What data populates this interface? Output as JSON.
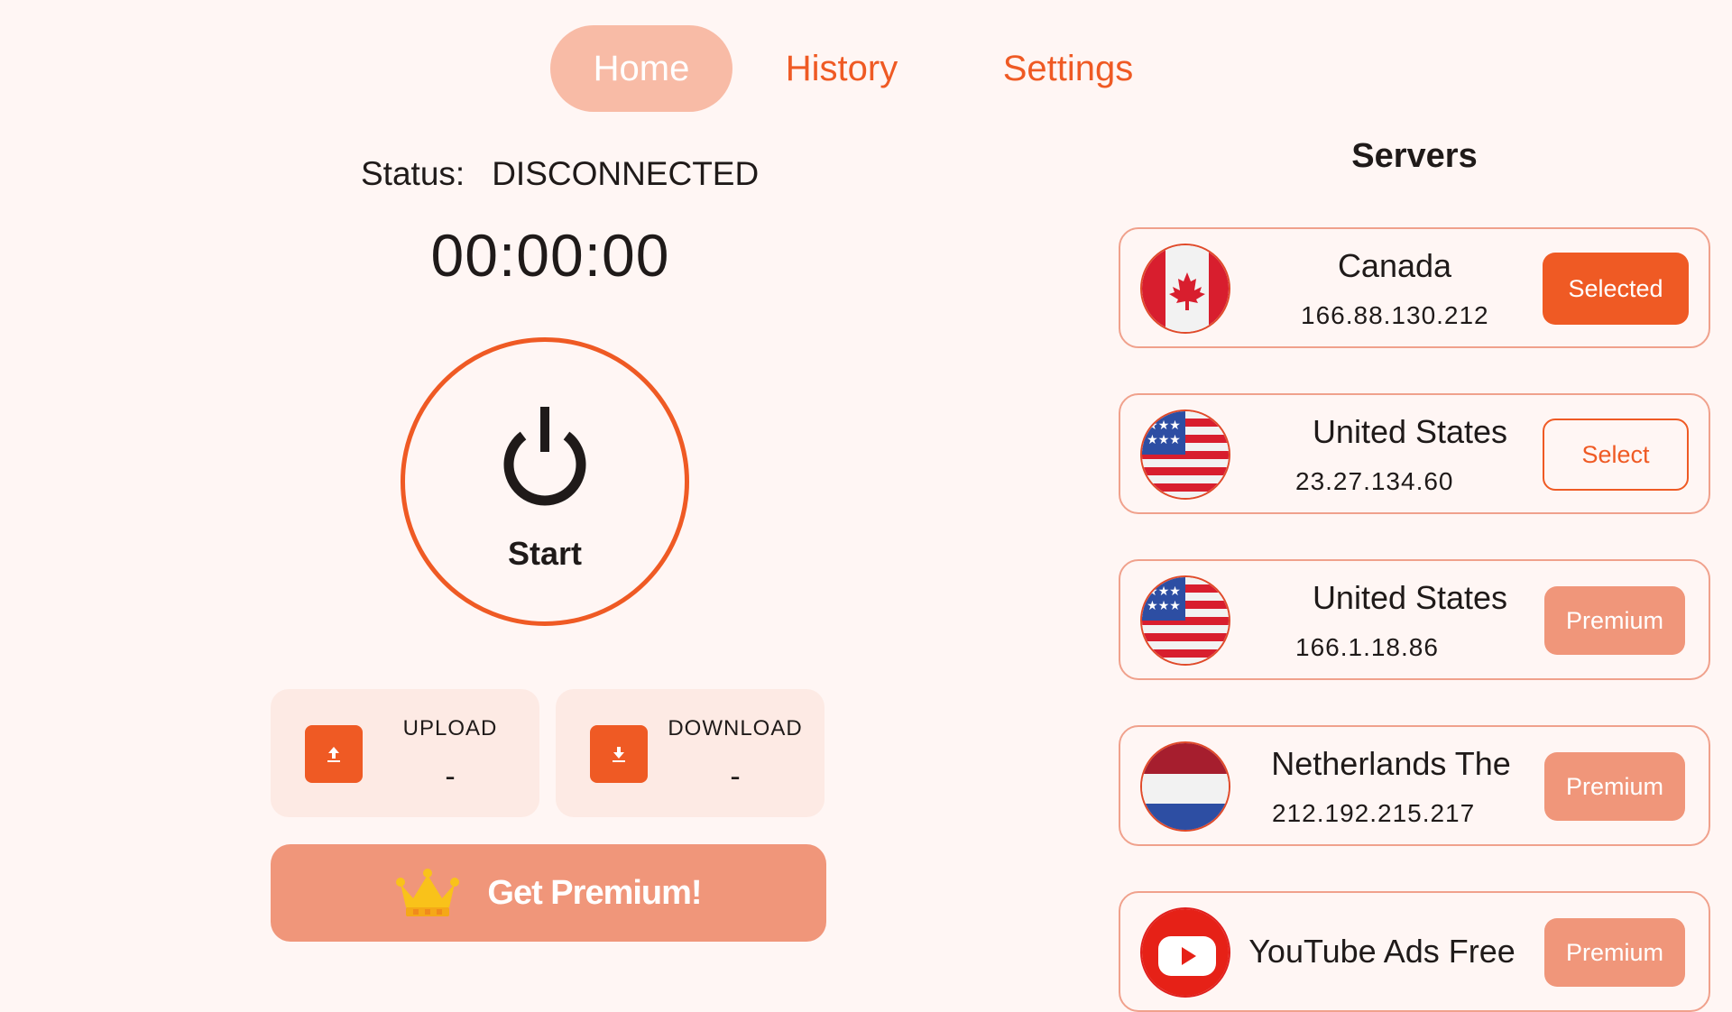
{
  "tabs": [
    {
      "label": "Home",
      "active": true
    },
    {
      "label": "History",
      "active": false
    },
    {
      "label": "Settings",
      "active": false
    }
  ],
  "status": {
    "label": "Status:",
    "value": "DISCONNECTED"
  },
  "timer": "00:00:00",
  "power": {
    "label": "Start",
    "icon": "power-icon"
  },
  "stats": {
    "upload": {
      "title": "UPLOAD",
      "value": "-",
      "icon": "upload-icon"
    },
    "download": {
      "title": "DOWNLOAD",
      "value": "-",
      "icon": "download-icon"
    }
  },
  "premium": {
    "label": "Get Premium!",
    "icon": "crown-icon"
  },
  "servers": {
    "title": "Servers",
    "items": [
      {
        "name": "Canada",
        "ip": "166.88.130.212",
        "flag": "canada-flag",
        "action": "Selected",
        "state": "selected"
      },
      {
        "name": "United States",
        "ip": "23.27.134.60",
        "flag": "usa-flag",
        "action": "Select",
        "state": "select"
      },
      {
        "name": "United States",
        "ip": "166.1.18.86",
        "flag": "usa-flag",
        "action": "Premium",
        "state": "premium"
      },
      {
        "name": "Netherlands The",
        "ip": "212.192.215.217",
        "flag": "netherlands-flag",
        "action": "Premium",
        "state": "premium"
      },
      {
        "name": "YouTube Ads Free",
        "ip": "",
        "flag": "youtube-logo",
        "action": "Premium",
        "state": "premium"
      }
    ]
  },
  "colors": {
    "accent": "#ef5a24",
    "accent_light": "#f0967a",
    "tab_active_bg": "#f8bba6",
    "background": "#fff6f4"
  }
}
